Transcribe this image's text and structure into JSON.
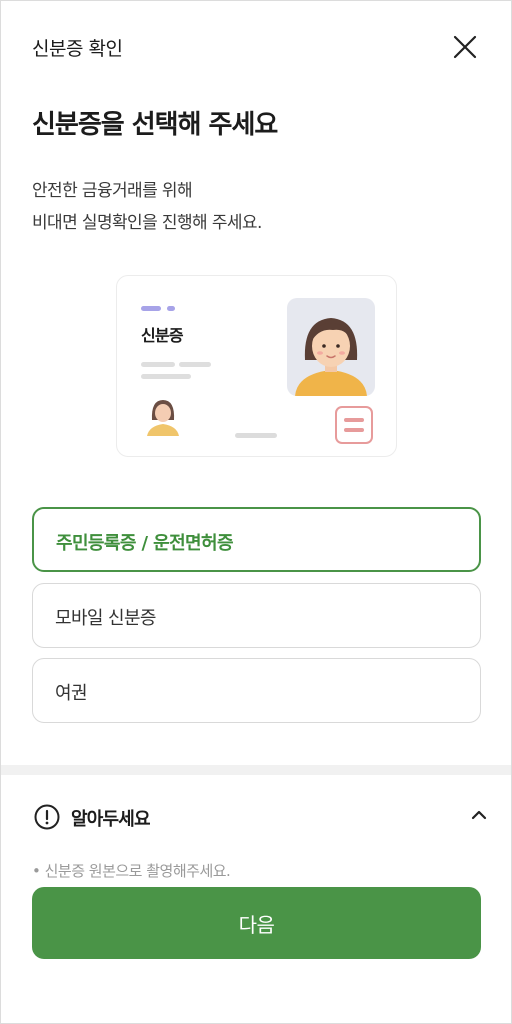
{
  "header": {
    "title": "신분증 확인",
    "close_icon": "close-icon"
  },
  "main": {
    "headline": "신분증을 선택해 주세요",
    "description_line1": "안전한 금융거래를 위해",
    "description_line2": "비대면 실명확인을 진행해 주세요.",
    "card_label": "신분증"
  },
  "options": [
    {
      "label": "주민등록증 / 운전면허증",
      "selected": true
    },
    {
      "label": "모바일 신분증",
      "selected": false
    },
    {
      "label": "여권",
      "selected": false
    }
  ],
  "notice": {
    "title": "알아두세요",
    "icon": "alert-circle-icon",
    "toggle_icon": "chevron-up-icon",
    "items": [
      "• 신분증 원본으로 촬영해주세요."
    ]
  },
  "footer": {
    "next_label": "다음"
  },
  "colors": {
    "accent": "#4a9447",
    "selected_text": "#3f8f3c",
    "stamp": "#e79b9b",
    "card_dots": "#a7a3e8"
  }
}
